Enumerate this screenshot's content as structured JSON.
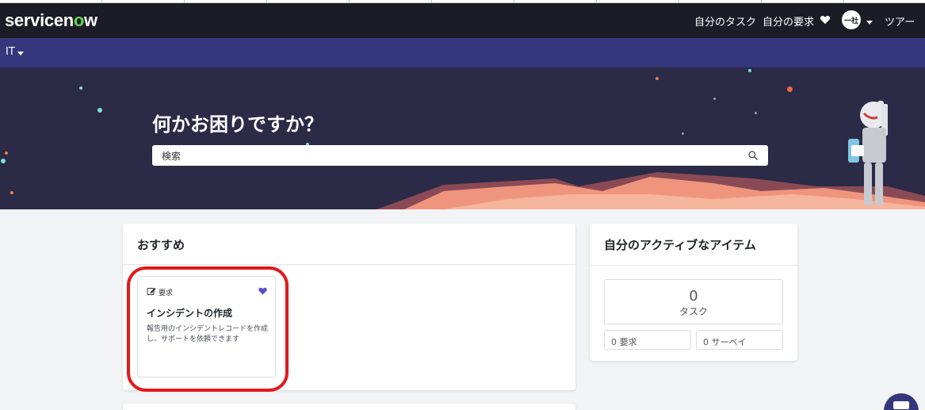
{
  "header": {
    "logo_text_a": "servicen",
    "logo_text_o": "o",
    "logo_text_b": "w",
    "my_tasks": "自分のタスク",
    "my_requests": "自分の要求",
    "avatar_initials": "一社",
    "tour": "ツアー"
  },
  "subnav": {
    "it_menu": "IT"
  },
  "hero": {
    "title": "何かお困りですか？",
    "search_placeholder": "検索"
  },
  "recommended": {
    "title": "おすすめ",
    "tile": {
      "tag": "要求",
      "title": "インシデントの作成",
      "description": "報告用のインシデントレコードを作成し、サポートを依頼できます"
    }
  },
  "active_items": {
    "title": "自分のアクティブなアイテム",
    "tasks_count": "0",
    "tasks_label": "タスク",
    "requests": "0 要求",
    "surveys": "0 サーベイ"
  },
  "colors": {
    "header_bg": "#1c1c27",
    "subnav_bg": "#34377c",
    "hero_bg": "#2b2a47",
    "accent_purple": "#5a4fcf",
    "highlight_red": "#e11b1b",
    "logo_green": "#62d84e"
  }
}
